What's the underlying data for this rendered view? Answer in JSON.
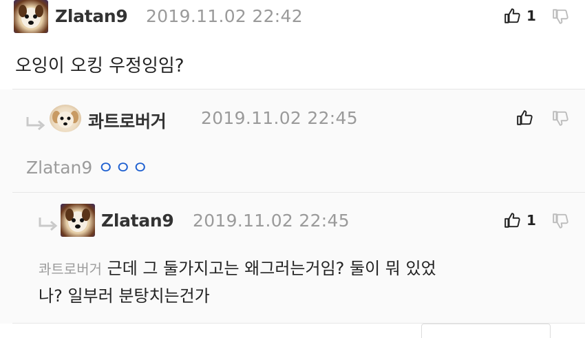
{
  "comments": [
    {
      "author": "Zlatan9",
      "time": "2019.11.02 22:42",
      "likes": "1",
      "body": "오잉이 오킹 우정잉임?"
    },
    {
      "author": "콰트로버거",
      "time": "2019.11.02 22:45",
      "mention": "Zlatan9",
      "body": "ㅇㅇㅇ"
    },
    {
      "author": "Zlatan9",
      "time": "2019.11.02 22:45",
      "likes": "1",
      "mention": "콰트로버거",
      "body_line1": "근데 그 둘가지고는 왜그러는거임? 둘이 뭐 있었",
      "body_line2": "나? 일부러 분탕치는건가"
    }
  ],
  "icons": {
    "like": "thumbs-up-icon",
    "dislike": "thumbs-down-icon",
    "reply": "reply-arrow-icon"
  },
  "colors": {
    "mention_gray": "#9c9c9c",
    "accent_blue": "#1d5fd0"
  }
}
